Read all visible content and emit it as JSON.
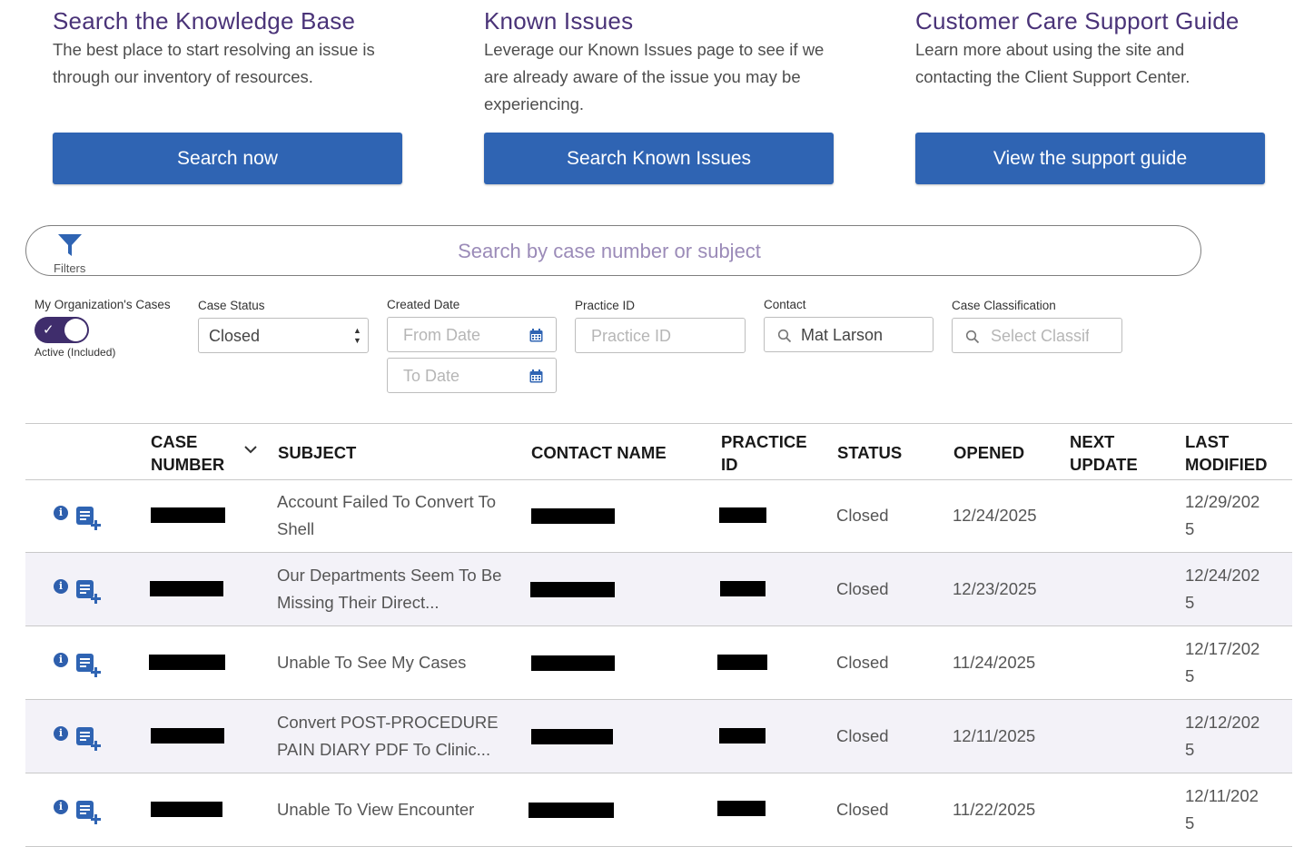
{
  "cards": [
    {
      "title": "Search the Knowledge Base",
      "desc": "The best place to start resolving an issue is through our inventory of resources.",
      "button": "Search now"
    },
    {
      "title": "Known Issues",
      "desc": "Leverage our Known Issues page to see if we are already aware of the issue you may be experiencing.",
      "button": "Search Known Issues"
    },
    {
      "title": "Customer Care Support Guide",
      "desc": "Learn more about using the site and contacting the Client Support Center.",
      "button": "View the support guide"
    }
  ],
  "search": {
    "filters_label": "Filters",
    "placeholder": "Search by case number or subject"
  },
  "filters": {
    "my_org_label": "My Organization's Cases",
    "toggle_caption": "Active (Included)",
    "toggle_on": true,
    "case_status_label": "Case Status",
    "case_status_value": "Closed",
    "created_date_label": "Created Date",
    "from_placeholder": "From Date",
    "to_placeholder": "To Date",
    "practice_id_label": "Practice ID",
    "practice_id_placeholder": "Practice ID",
    "contact_label": "Contact",
    "contact_value": "Mat Larson",
    "classification_label": "Case Classification",
    "classification_placeholder": "Select Classification"
  },
  "table": {
    "headers": {
      "case_number_1": "CASE",
      "case_number_2": "NUMBER",
      "subject": "SUBJECT",
      "contact_name": "CONTACT NAME",
      "practice_id_1": "PRACTICE",
      "practice_id_2": "ID",
      "status": "STATUS",
      "opened": "OPENED",
      "next_update_1": "NEXT",
      "next_update_2": "UPDATE",
      "last_modified_1": "LAST",
      "last_modified_2": "MODIFIED"
    },
    "rows": [
      {
        "subject_1": "Account Failed To Convert To",
        "subject_2": "Shell",
        "status": "Closed",
        "opened": "12/24/2025",
        "next_update": "",
        "modified_1": "12/29/202",
        "modified_2": "5"
      },
      {
        "subject_1": "Our Departments Seem To Be",
        "subject_2": "Missing Their Direct...",
        "status": "Closed",
        "opened": "12/23/2025",
        "next_update": "",
        "modified_1": "12/24/202",
        "modified_2": "5"
      },
      {
        "subject_1": "Unable To See My Cases",
        "subject_2": "",
        "status": "Closed",
        "opened": "11/24/2025",
        "next_update": "",
        "modified_1": "12/17/202",
        "modified_2": "5"
      },
      {
        "subject_1": "Convert POST-PROCEDURE",
        "subject_2": "PAIN DIARY PDF To Clinic...",
        "status": "Closed",
        "opened": "12/11/2025",
        "next_update": "",
        "modified_1": "12/12/202",
        "modified_2": "5"
      },
      {
        "subject_1": "Unable To View Encounter",
        "subject_2": "",
        "status": "Closed",
        "opened": "11/22/2025",
        "next_update": "",
        "modified_1": "12/11/202",
        "modified_2": "5"
      }
    ]
  },
  "icons": {
    "filter": "filter-funnel-icon",
    "calendar": "calendar-icon",
    "search": "magnifier-icon",
    "info": "info-icon",
    "add_note": "add-note-icon",
    "sort": "chevron-down-icon"
  },
  "colors": {
    "accent": "#2f64b3",
    "heading": "#4a3378",
    "toggle": "#3f2d6c",
    "row_alt": "#f3f2f8"
  }
}
